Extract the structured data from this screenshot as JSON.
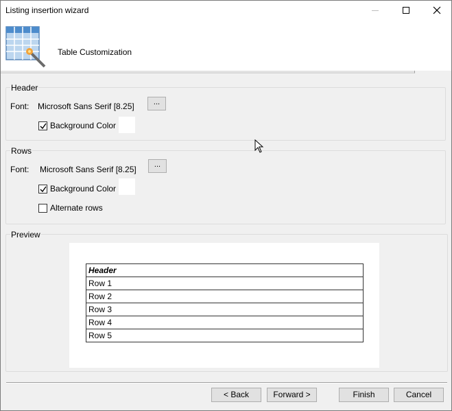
{
  "window": {
    "title": "Listing insertion wizard",
    "controls": {
      "minimize": "minimize-icon",
      "maximize": "maximize-icon",
      "close": "close-icon"
    }
  },
  "header": {
    "icon": "table-wizard-icon",
    "step_title": "Table Customization"
  },
  "header_group": {
    "label": "Header",
    "font_label": "Font:",
    "font_value": "Microsoft Sans Serif [8.25]",
    "browse_label": "...",
    "background_label": "Background Color",
    "background_checked": true,
    "background_color": "#ffffff"
  },
  "rows_group": {
    "label": "Rows",
    "font_label": "Font:",
    "font_value": "Microsoft Sans Serif [8.25]",
    "browse_label": "...",
    "background_label": "Background Color",
    "background_checked": true,
    "background_color": "#ffffff",
    "alternate_label": "Alternate rows",
    "alternate_checked": false
  },
  "preview": {
    "label": "Preview",
    "table": {
      "header": "Header",
      "rows": [
        "Row 1",
        "Row 2",
        "Row 3",
        "Row 4",
        "Row 5"
      ]
    }
  },
  "footer": {
    "back": "< Back",
    "forward": "Forward >",
    "finish": "Finish",
    "cancel": "Cancel"
  }
}
